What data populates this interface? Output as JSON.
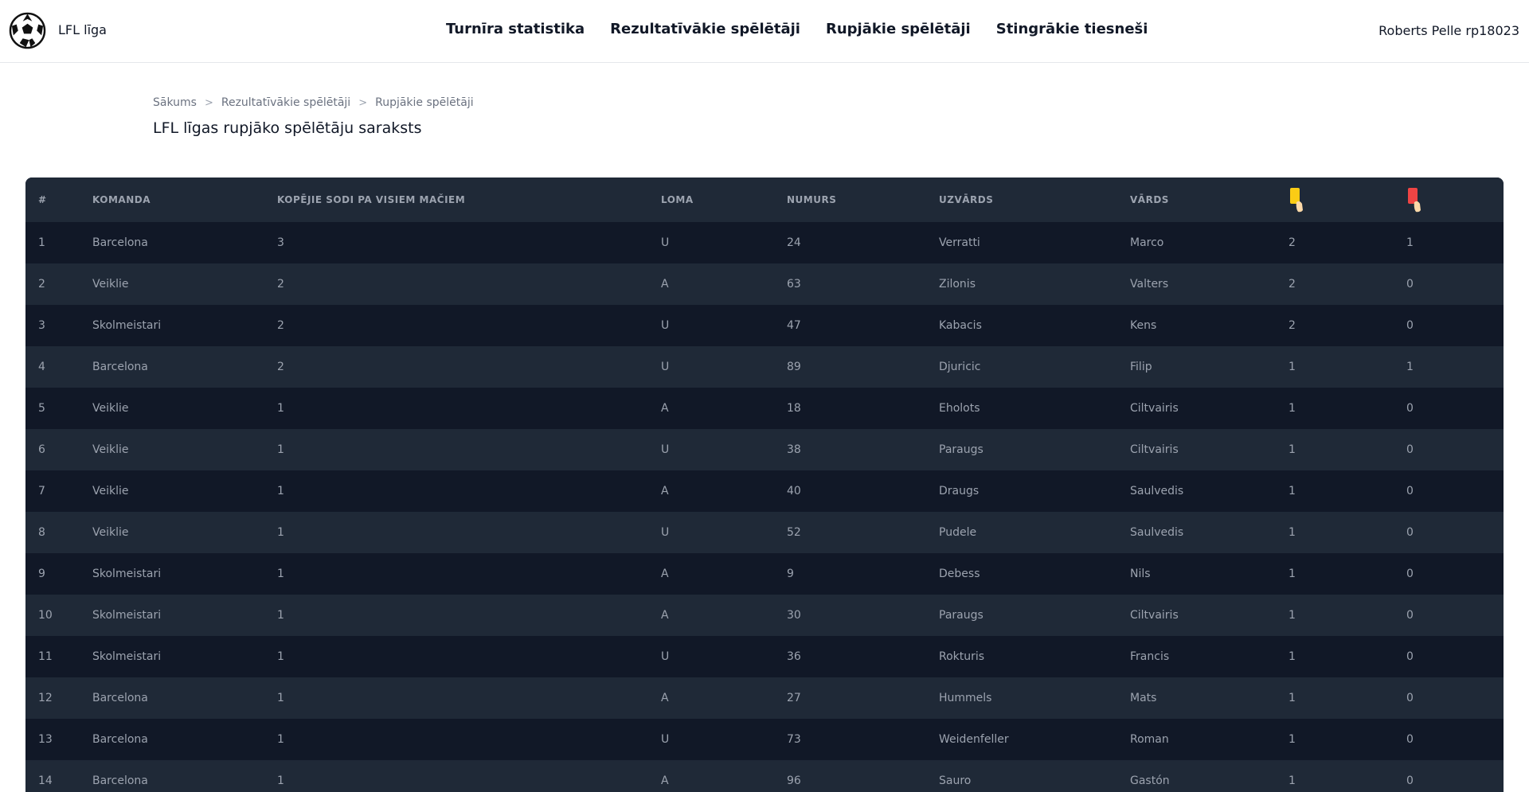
{
  "header": {
    "brand": "LFL līga",
    "nav": [
      "Turnīra statistika",
      "Rezultatīvākie spēlētāji",
      "Rupjākie spēlētāji",
      "Stingrākie tiesneši"
    ],
    "user": "Roberts Pelle rp18023"
  },
  "breadcrumb": [
    "Sākums",
    "Rezultatīvākie spēlētāji",
    "Rupjākie spēlētāji"
  ],
  "page_title": "LFL līgas rupjāko spēlētāju saraksts",
  "table": {
    "columns": [
      "#",
      "Komanda",
      "Kopējie sodi pa visiem mačiem",
      "Loma",
      "Numurs",
      "Uzvārds",
      "Vārds",
      "yellow-card-icon",
      "red-card-icon"
    ],
    "card_colors": {
      "yellow": "#facc15",
      "red": "#ef4444"
    },
    "rows": [
      [
        "1",
        "Barcelona",
        "3",
        "U",
        "24",
        "Verratti",
        "Marco",
        "2",
        "1"
      ],
      [
        "2",
        "Veiklie",
        "2",
        "A",
        "63",
        "Zilonis",
        "Valters",
        "2",
        "0"
      ],
      [
        "3",
        "Skolmeistari",
        "2",
        "U",
        "47",
        "Kabacis",
        "Kens",
        "2",
        "0"
      ],
      [
        "4",
        "Barcelona",
        "2",
        "U",
        "89",
        "Djuricic",
        "Filip",
        "1",
        "1"
      ],
      [
        "5",
        "Veiklie",
        "1",
        "A",
        "18",
        "Eholots",
        "Ciltvairis",
        "1",
        "0"
      ],
      [
        "6",
        "Veiklie",
        "1",
        "U",
        "38",
        "Paraugs",
        "Ciltvairis",
        "1",
        "0"
      ],
      [
        "7",
        "Veiklie",
        "1",
        "A",
        "40",
        "Draugs",
        "Saulvedis",
        "1",
        "0"
      ],
      [
        "8",
        "Veiklie",
        "1",
        "U",
        "52",
        "Pudele",
        "Saulvedis",
        "1",
        "0"
      ],
      [
        "9",
        "Skolmeistari",
        "1",
        "A",
        "9",
        "Debess",
        "Nils",
        "1",
        "0"
      ],
      [
        "10",
        "Skolmeistari",
        "1",
        "A",
        "30",
        "Paraugs",
        "Ciltvairis",
        "1",
        "0"
      ],
      [
        "11",
        "Skolmeistari",
        "1",
        "U",
        "36",
        "Rokturis",
        "Francis",
        "1",
        "0"
      ],
      [
        "12",
        "Barcelona",
        "1",
        "A",
        "27",
        "Hummels",
        "Mats",
        "1",
        "0"
      ],
      [
        "13",
        "Barcelona",
        "1",
        "U",
        "73",
        "Weidenfeller",
        "Roman",
        "1",
        "0"
      ],
      [
        "14",
        "Barcelona",
        "1",
        "A",
        "96",
        "Sauro",
        "Gastón",
        "1",
        "0"
      ]
    ]
  }
}
